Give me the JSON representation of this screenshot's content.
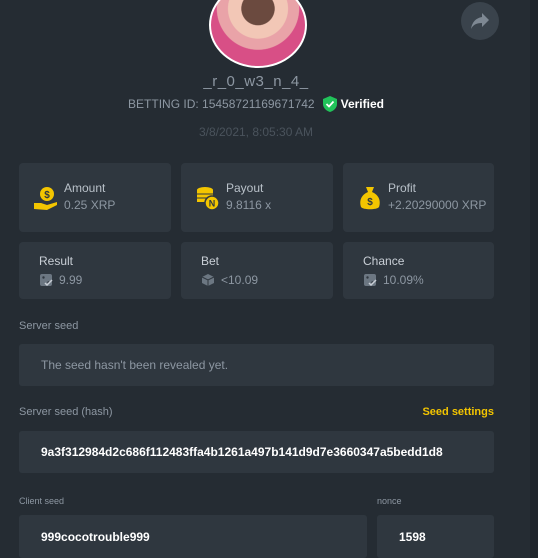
{
  "profile": {
    "username": "_r_0_w3_n_4_",
    "betting_id_label": "BETTING ID: 15458721169671742",
    "verified_label": "Verified",
    "date": "3/8/2021, 8:05:30 AM"
  },
  "stats": {
    "amount": {
      "label": "Amount",
      "value": "0.25 XRP"
    },
    "payout": {
      "label": "Payout",
      "value": "9.8116 x"
    },
    "profit": {
      "label": "Profit",
      "value": "+2.20290000 XRP"
    },
    "result": {
      "label": "Result",
      "value": "9.99"
    },
    "bet": {
      "label": "Bet",
      "value": "<10.09"
    },
    "chance": {
      "label": "Chance",
      "value": "10.09%"
    }
  },
  "server_seed": {
    "label": "Server seed",
    "value": "The seed hasn't been revealed yet."
  },
  "server_seed_hash": {
    "label": "Server seed (hash)",
    "settings_link": "Seed settings",
    "value": "9a3f312984d2c686f112483ffa4b1261a497b141d9d7e3660347a5bedd1d8"
  },
  "client": {
    "client_label": "Client seed",
    "client_value": "999cocotrouble999",
    "nonce_label": "nonce",
    "nonce_value": "1598"
  },
  "colors": {
    "background": "#252c33",
    "card": "#2f373f",
    "accent": "#f3c500",
    "verified": "#21c35a"
  },
  "icons": [
    "share-icon",
    "verified-shield-icon",
    "coin-hand-icon",
    "coins-stack-icon",
    "money-bag-icon",
    "dice-icon",
    "cube-icon"
  ]
}
